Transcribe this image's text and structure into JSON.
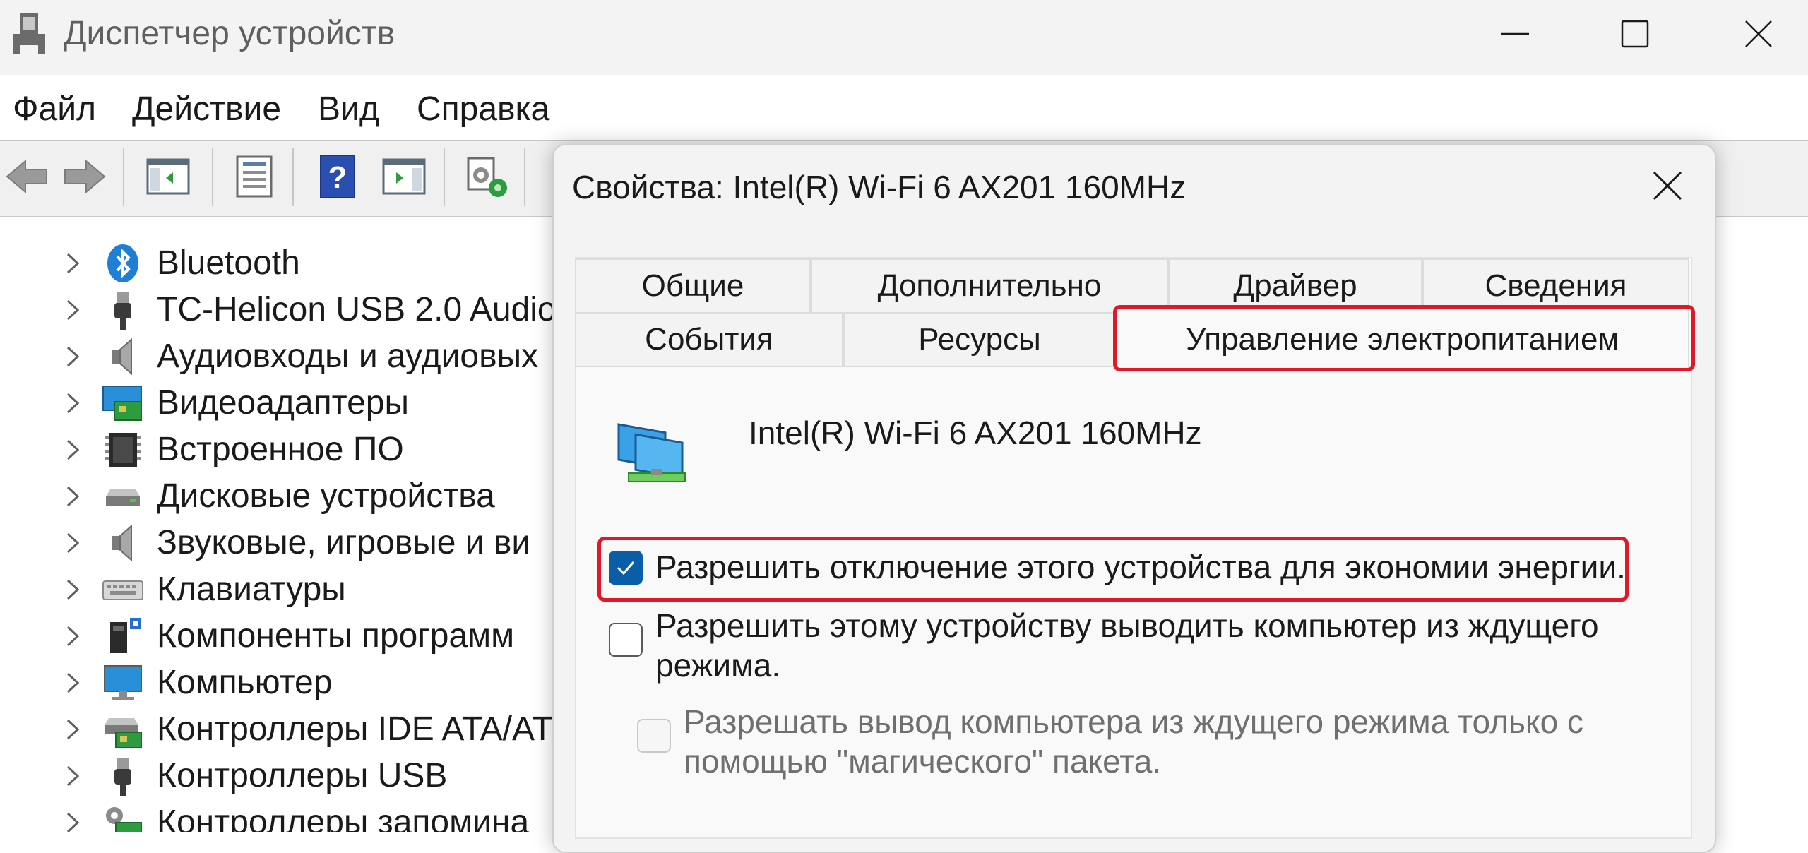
{
  "window": {
    "title": "Диспетчер устройств"
  },
  "menu": {
    "file": "Файл",
    "action": "Действие",
    "view": "Вид",
    "help": "Справка"
  },
  "tree": {
    "items": [
      {
        "label": "Bluetooth",
        "icon": "bluetooth-icon"
      },
      {
        "label": "TC-Helicon USB 2.0 Audio",
        "icon": "usb-audio-icon"
      },
      {
        "label": "Аудиовходы и аудиовых",
        "icon": "speaker-icon"
      },
      {
        "label": "Видеоадаптеры",
        "icon": "display-adapter-icon"
      },
      {
        "label": "Встроенное ПО",
        "icon": "firmware-chip-icon"
      },
      {
        "label": "Дисковые устройства",
        "icon": "disk-drive-icon"
      },
      {
        "label": "Звуковые, игровые и ви",
        "icon": "speaker-icon"
      },
      {
        "label": "Клавиатуры",
        "icon": "keyboard-icon"
      },
      {
        "label": "Компоненты программ",
        "icon": "software-component-icon"
      },
      {
        "label": "Компьютер",
        "icon": "monitor-icon"
      },
      {
        "label": "Контроллеры IDE ATA/AT",
        "icon": "ide-controller-icon"
      },
      {
        "label": "Контроллеры USB",
        "icon": "usb-plug-icon"
      },
      {
        "label": "Контроллеры запомина",
        "icon": "storage-controller-icon"
      }
    ]
  },
  "dialog": {
    "title": "Свойства: Intel(R) Wi-Fi 6 AX201 160MHz",
    "tabs": {
      "general": "Общие",
      "advanced": "Дополнительно",
      "driver": "Драйвер",
      "details": "Сведения",
      "events": "События",
      "resources": "Ресурсы",
      "power": "Управление электропитанием"
    },
    "device_name": "Intel(R) Wi-Fi 6 AX201 160MHz",
    "options": {
      "allow_off": "Разрешить отключение этого устройства для экономии энергии.",
      "allow_off_checked": true,
      "allow_wake": "Разрешить этому устройству выводить компьютер из ждущего режима.",
      "allow_wake_checked": false,
      "magic_packet": "Разрешать вывод компьютера из ждущего режима только с помощью \"магического\" пакета.",
      "magic_packet_checked": false
    }
  },
  "colors": {
    "accent": "#0a5ea8",
    "highlight": "#e0192a"
  }
}
